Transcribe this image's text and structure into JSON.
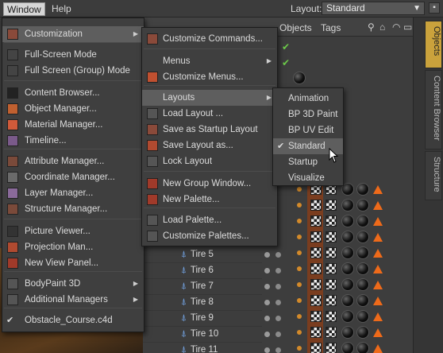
{
  "menubar": {
    "window": "Window",
    "help": "Help",
    "layout_label": "Layout:",
    "layout_value": "Standard"
  },
  "om": {
    "tabs": [
      "Objects",
      "Tags"
    ]
  },
  "side_tabs": [
    "Objects",
    "Content Browser",
    "Structure"
  ],
  "tree": [
    "Tire 5",
    "Tire 6",
    "Tire 7",
    "Tire 8",
    "Tire 9",
    "Tire 10",
    "Tire 11"
  ],
  "window_menu": [
    {
      "label": "Customization",
      "sub": true,
      "hl": true
    },
    {
      "label": "Full-Screen Mode"
    },
    {
      "label": "Full Screen (Group) Mode"
    },
    {
      "label": "Content Browser..."
    },
    {
      "label": "Object Manager..."
    },
    {
      "label": "Material Manager..."
    },
    {
      "label": "Timeline..."
    },
    {
      "label": "Attribute Manager..."
    },
    {
      "label": "Coordinate Manager..."
    },
    {
      "label": "Layer Manager..."
    },
    {
      "label": "Structure Manager..."
    },
    {
      "label": "Picture Viewer..."
    },
    {
      "label": "Projection Man..."
    },
    {
      "label": "New View Panel..."
    },
    {
      "label": "BodyPaint 3D",
      "sub": true
    },
    {
      "label": "Additional Managers",
      "sub": true
    },
    {
      "label": "Obstacle_Course.c4d",
      "check": true
    }
  ],
  "custom_menu": [
    {
      "label": "Customize Commands..."
    },
    {
      "label": "Menus",
      "sub": true
    },
    {
      "label": "Customize Menus..."
    },
    {
      "label": "Layouts",
      "sub": true,
      "hl": true
    },
    {
      "label": "Load Layout ..."
    },
    {
      "label": "Save as Startup Layout"
    },
    {
      "label": "Save Layout as..."
    },
    {
      "label": "Lock Layout"
    },
    {
      "label": "New Group Window..."
    },
    {
      "label": "New Palette..."
    },
    {
      "label": "Load Palette..."
    },
    {
      "label": "Customize Palettes..."
    }
  ],
  "layouts_menu": [
    {
      "label": "Animation"
    },
    {
      "label": "BP 3D Paint"
    },
    {
      "label": "BP UV Edit"
    },
    {
      "label": "Standard",
      "check": true,
      "hl": true
    },
    {
      "label": "Startup"
    },
    {
      "label": "Visualize"
    }
  ],
  "colors": {
    "accent_tab": "#caa23c",
    "tag_orange": "#ee6a1a",
    "bone_blue": "#77aaee",
    "menu_highlight": "#5e5e5e"
  }
}
